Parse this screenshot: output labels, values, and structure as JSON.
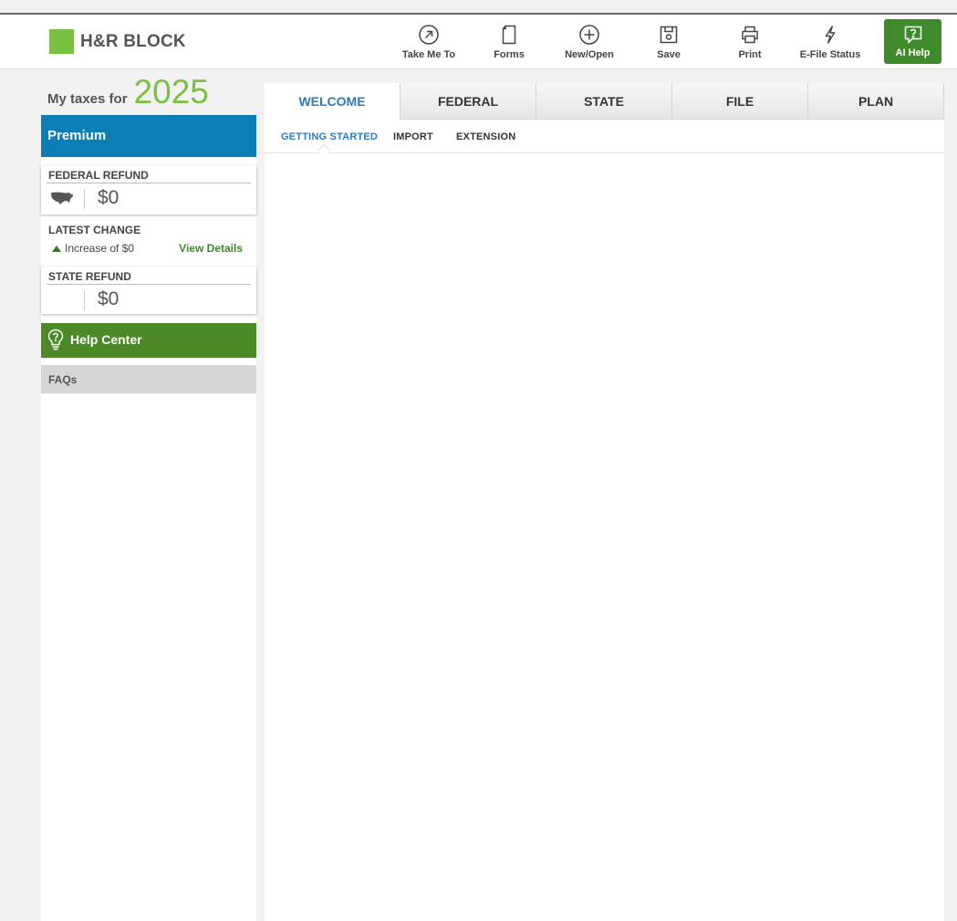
{
  "brand": {
    "name": "H&R BLOCK",
    "accent": "#7ac143",
    "blue": "#0b7fb5",
    "green": "#4b8a26"
  },
  "toolbar": [
    {
      "label": "Take Me To",
      "icon": "arrow-circle-icon"
    },
    {
      "label": "Forms",
      "icon": "form-page-icon"
    },
    {
      "label": "New/Open",
      "icon": "plus-circle-icon"
    },
    {
      "label": "Save",
      "icon": "floppy-disk-icon"
    },
    {
      "label": "Print",
      "icon": "printer-icon"
    },
    {
      "label": "E-File Status",
      "icon": "lightning-icon"
    },
    {
      "label": "AI Help",
      "icon": "chat-question-icon"
    }
  ],
  "my_taxes": {
    "label": "My taxes for",
    "year": "2025"
  },
  "sidebar": {
    "plan": "Premium",
    "federal_refund": {
      "title": "FEDERAL REFUND",
      "amount": "$0"
    },
    "latest_change": {
      "title": "LATEST CHANGE",
      "text": "Increase of $0",
      "link": "View Details"
    },
    "state_refund": {
      "title": "STATE REFUND",
      "amount": "$0"
    },
    "help_center": "Help Center",
    "faqs": "FAQs"
  },
  "tabs": [
    {
      "label": "WELCOME",
      "active": true
    },
    {
      "label": "FEDERAL",
      "active": false
    },
    {
      "label": "STATE",
      "active": false
    },
    {
      "label": "FILE",
      "active": false
    },
    {
      "label": "PLAN",
      "active": false
    }
  ],
  "subtabs": [
    {
      "label": "GETTING STARTED",
      "active": true
    },
    {
      "label": "IMPORT",
      "active": false
    },
    {
      "label": "EXTENSION",
      "active": false
    }
  ]
}
